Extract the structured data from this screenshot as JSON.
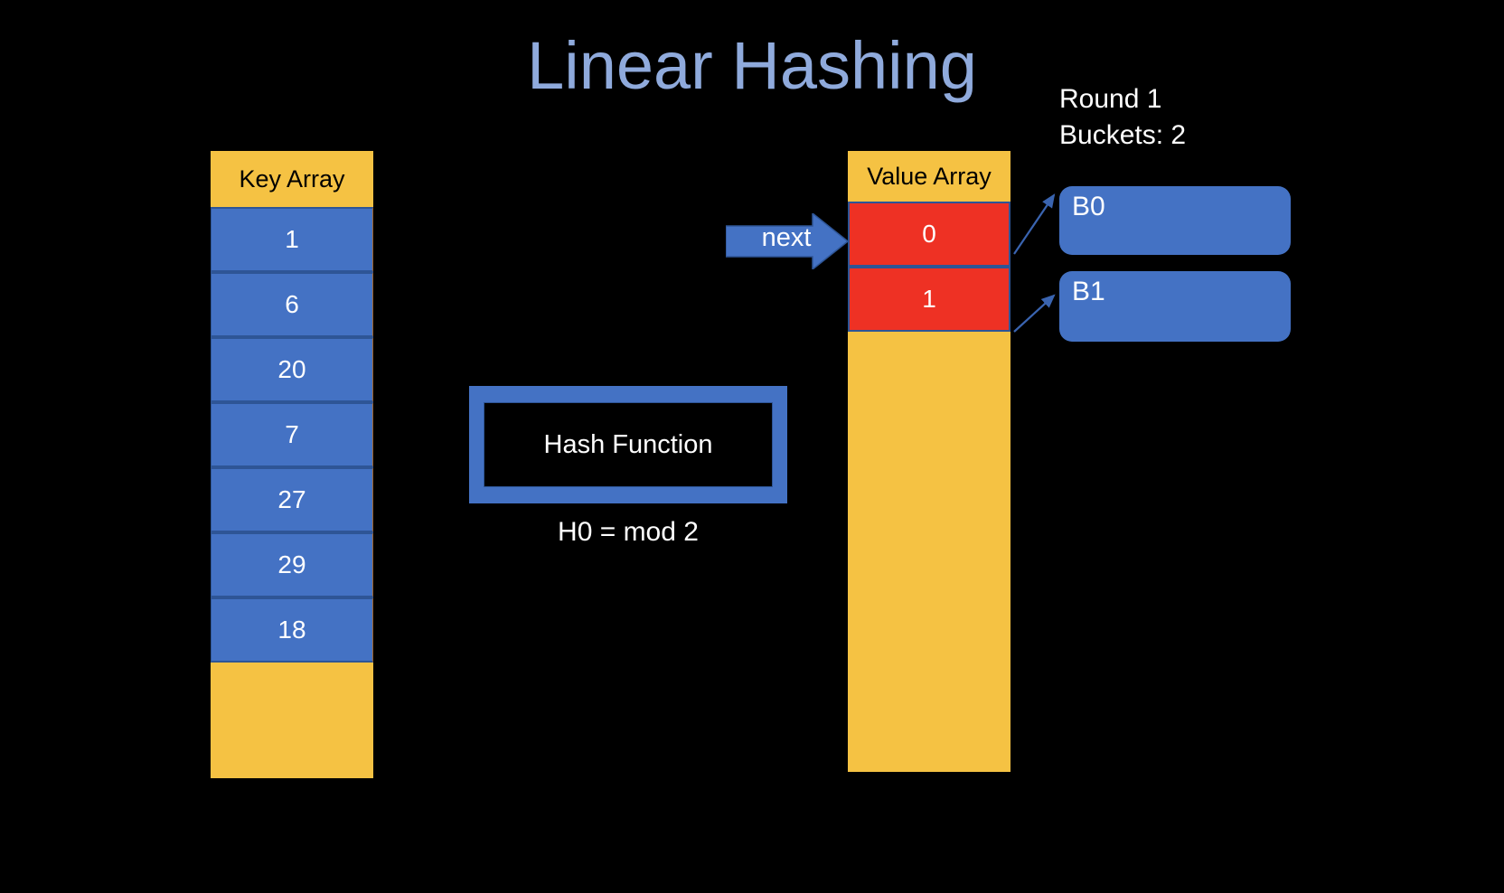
{
  "slide": {
    "title": "Linear Hashing",
    "background_color": "#000000",
    "title_color": "#8FAADC"
  },
  "colors": {
    "blue": "#4472C4",
    "gold": "#F5C243",
    "red": "#EE3124",
    "white": "#FFFFFF",
    "border_blue": "#2E5596",
    "title_blue": "#8FAADC"
  },
  "key_array": {
    "header": "Key Array",
    "cells": [
      "1",
      "6",
      "20",
      "7",
      "27",
      "29",
      "18"
    ],
    "empty_tail": ""
  },
  "value_array": {
    "header": "Value Array",
    "cells": [
      "0",
      "1"
    ],
    "empty_tail": ""
  },
  "next_pointer": {
    "label": "next",
    "icon": "right-arrow-icon"
  },
  "hash_function": {
    "label": "Hash Function",
    "formula": "H0 = mod 2"
  },
  "round_info": {
    "round": "Round 1",
    "buckets": "Buckets: 2"
  },
  "buckets": [
    {
      "label": "B0"
    },
    {
      "label": "B1"
    }
  ]
}
